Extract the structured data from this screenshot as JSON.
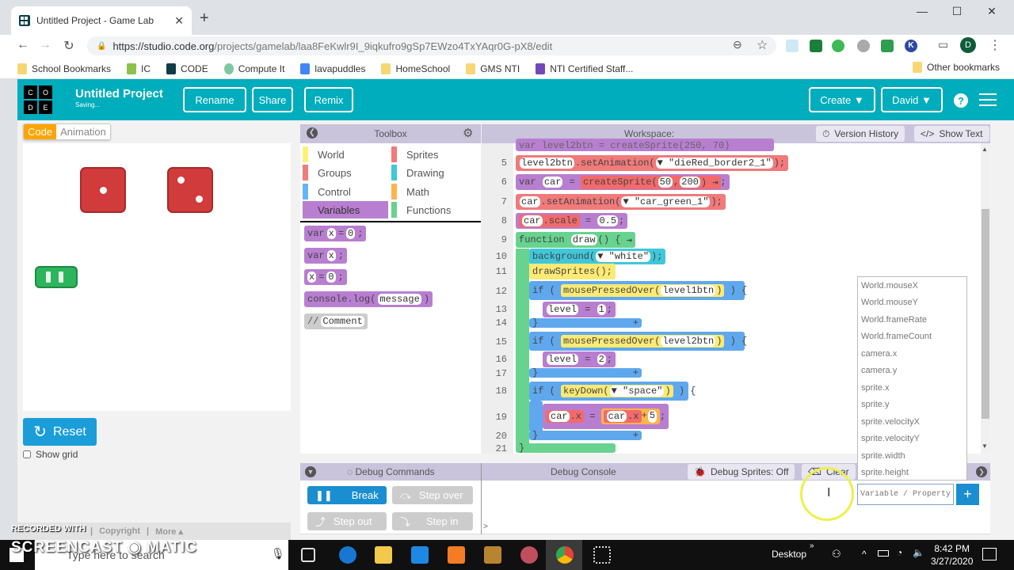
{
  "browser": {
    "tab_title": "Untitled Project - Game Lab",
    "url_host": "https://studio.code.org",
    "url_path": "/projects/gamelab/laa8FeKwlr9I_9iqkufro9gSp7EWzo4TxYAqr0G-pX8/edit",
    "bookmarks": [
      "School Bookmarks",
      "IC",
      "CODE",
      "Compute It",
      "lavapuddles",
      "HomeSchool",
      "GMS NTI",
      "NTI Certified Staff..."
    ],
    "other_bookmarks": "Other bookmarks",
    "profile_initial": "D",
    "ext_k": "K"
  },
  "header": {
    "logo_letters": [
      "C",
      "O",
      "D",
      "E"
    ],
    "project_title": "Untitled Project",
    "project_status": "Saving...",
    "rename": "Rename",
    "share": "Share",
    "remix": "Remix",
    "create": "Create ▼",
    "user": "David ▼",
    "help": "?"
  },
  "left": {
    "tab_code": "Code",
    "tab_animation": "Animation",
    "reset": "Reset",
    "show_grid": "Show grid",
    "footer_copyright": "Copyright",
    "footer_more": "More ▴",
    "footer_sep": "|"
  },
  "toolbox": {
    "title": "Toolbox",
    "categories": [
      {
        "label": "World",
        "color": "#fff176"
      },
      {
        "label": "Sprites",
        "color": "#f17a7a"
      },
      {
        "label": "Groups",
        "color": "#f17a7a"
      },
      {
        "label": "Drawing",
        "color": "#40c7da"
      },
      {
        "label": "Control",
        "color": "#64b5f6"
      },
      {
        "label": "Math",
        "color": "#ffb34d"
      },
      {
        "label": "Variables",
        "color": "#b87ed0"
      },
      {
        "label": "Functions",
        "color": "#68d28f"
      }
    ],
    "blocks": {
      "b1_kw": "var",
      "b1_a": "x",
      "b1_eq": "=",
      "b1_b": "0",
      "b1_end": ";",
      "b2_kw": "var",
      "b2_a": "x",
      "b2_end": ";",
      "b3_a": "x",
      "b3_eq": "=",
      "b3_b": "0",
      "b3_end": ";",
      "b4_fn": "console.log(",
      "b4_arg": "message",
      "b4_end": ")",
      "b5_kw": "//",
      "b5_text": "Comment"
    }
  },
  "workspace": {
    "label": "Workspace:",
    "version_history": "Version History",
    "show_text": "Show Text",
    "line_numbers": [
      "5",
      "6",
      "7",
      "8",
      "9",
      "10",
      "11",
      "12",
      "13",
      "14",
      "15",
      "16",
      "17",
      "18",
      "19",
      "20",
      "21"
    ],
    "code": {
      "l4": "var level2btn = createSprite(250, 70)",
      "l5_var": "level2btn",
      "l5_fn": ".setAnimation(",
      "l5_arg": "▼ \"dieRed_border2_1\"",
      "l5_end": ");",
      "l6_kw": "var",
      "l6_var": "car",
      "l6_eq": "=",
      "l6_fn": "createSprite(",
      "l6_a": "50",
      "l6_b": "200",
      "l6_end": ");",
      "l7_var": "car",
      "l7_fn": ".setAnimation(",
      "l7_arg": "▼ \"car_green_1\"",
      "l7_end": ");",
      "l8_var": "car",
      "l8_prop": ".scale",
      "l8_eq": "=",
      "l8_val": "0.5",
      "l8_end": ";",
      "l9_kw": "function",
      "l9_name": "draw",
      "l9_end": "() {",
      "l10_fn": "background(",
      "l10_arg": "▼ \"white\"",
      "l10_end": ");",
      "l11": "drawSprites();",
      "l12_kw": "if (",
      "l12_fn": "mousePressedOver(",
      "l12_arg": "level1btn",
      "l12_end": ") {",
      "l13_var": "level",
      "l13_eq": "=",
      "l13_val": "1",
      "l13_end": ";",
      "l14": "}",
      "l15_kw": "if (",
      "l15_fn": "mousePressedOver(",
      "l15_arg": "level2btn",
      "l15_end": ") {",
      "l16_var": "level",
      "l16_eq": "=",
      "l16_val": "2",
      "l16_end": ";",
      "l17": "}",
      "l18_kw": "if (",
      "l18_fn": "keyDown(",
      "l18_arg": "▼ \"space\"",
      "l18_end": ") {",
      "l19_var": "car",
      "l19_prop": ".x",
      "l19_eq": "=",
      "l19_rvar": "car",
      "l19_rprop": ".x",
      "l19_op": "+",
      "l19_val": "5",
      "l19_end": ";",
      "l20": "}",
      "l21": "}",
      "plus": "+"
    }
  },
  "autocomplete": {
    "items": [
      "World.mouseX",
      "World.mouseY",
      "World.frameRate",
      "World.frameCount",
      "camera.x",
      "camera.y",
      "sprite.x",
      "sprite.y",
      "sprite.velocityX",
      "sprite.velocityY",
      "sprite.width",
      "sprite.height"
    ]
  },
  "debug": {
    "commands_label": "Debug Commands",
    "console_label": "Debug Console",
    "sprites_toggle": "Debug Sprites: Off",
    "clear": "Clear",
    "break": "Break",
    "step_over": "Step over",
    "step_out": "Step out",
    "step_in": "Step in",
    "prompt": ">",
    "watch_placeholder": "Variable / Property",
    "watch_add": "+"
  },
  "taskbar": {
    "search_placeholder": "Type here to search",
    "desktop": "Desktop",
    "time": "8:42 PM",
    "date": "3/27/2020"
  },
  "watermark": {
    "line1": "RECORDED WITH",
    "line2": "SCREENCAST ◉ MATIC"
  }
}
